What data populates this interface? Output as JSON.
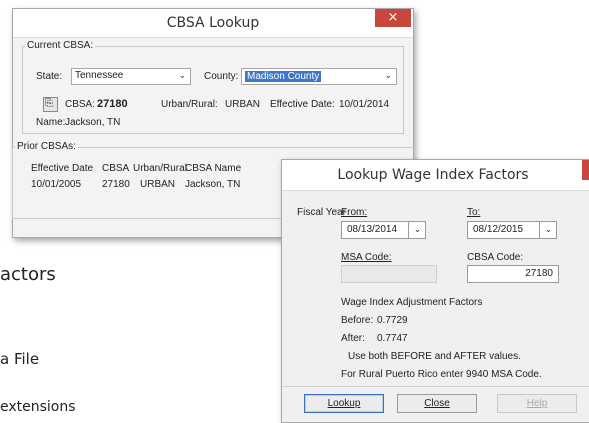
{
  "background": {
    "line1": "actors",
    "line2": "a File",
    "line3": "extensions"
  },
  "cbsa_window": {
    "title": "CBSA Lookup",
    "close_glyph": "×",
    "current_group_label": "Current CBSA:",
    "state_label": "State:",
    "state_value": "Tennessee",
    "county_label": "County:",
    "county_value": "Madison County",
    "cbsa_label": "CBSA:",
    "cbsa_value": "27180",
    "urban_rural_label": "Urban/Rural:",
    "urban_rural_value": "URBAN",
    "effective_date_label": "Effective Date:",
    "effective_date_value": "10/01/2014",
    "name_label": "Name:",
    "name_value": "Jackson, TN",
    "prior_group_label": "Prior CBSAs:",
    "prior_table": {
      "headers": [
        "Effective Date",
        "CBSA",
        "Urban/Rural",
        "CBSA Name"
      ],
      "rows": [
        [
          "10/01/2005",
          "27180",
          "URBAN",
          "Jackson, TN"
        ]
      ]
    }
  },
  "wage_window": {
    "title": "Lookup Wage Index Factors",
    "close_glyph": "×",
    "fiscal_year_label": "Fiscal Year",
    "from_label": "From:",
    "from_value": "08/13/2014",
    "to_label": "To:",
    "to_value": "08/12/2015",
    "msa_code_label": "MSA Code:",
    "msa_code_value": "",
    "cbsa_code_label": "CBSA Code:",
    "cbsa_code_value": "27180",
    "factors_heading": "Wage Index Adjustment Factors",
    "before_label": "Before:",
    "before_value": "0.7729",
    "after_label": "After:",
    "after_value": "0.7747",
    "note1": "Use both BEFORE and AFTER values.",
    "note2": "For Rural Puerto Rico enter 9940 MSA Code.",
    "buttons": {
      "lookup": "Lookup",
      "close": "Close",
      "help": "Help"
    }
  },
  "icons": {
    "copy": "copy-icon",
    "dropdown": "chevron-down-icon",
    "close": "close-icon"
  }
}
